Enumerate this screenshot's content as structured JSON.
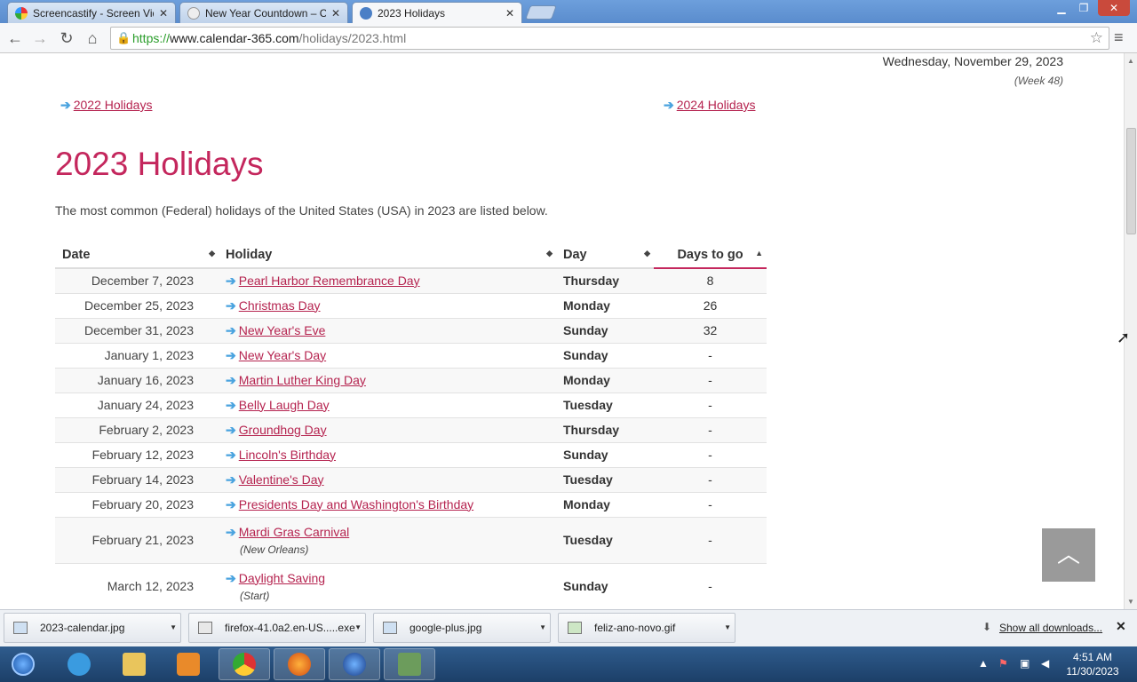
{
  "browser": {
    "tabs": [
      {
        "title": "Screencastify - Screen Vid",
        "active": false
      },
      {
        "title": "New Year Countdown – C",
        "active": false
      },
      {
        "title": "2023 Holidays",
        "active": true
      }
    ],
    "url_scheme": "https://",
    "url_host": "www.calendar-365.com",
    "url_path": "/holidays/2023.html"
  },
  "page": {
    "current_date": "Wednesday, November 29, 2023",
    "current_week": "(Week 48)",
    "prev_link": "2022 Holidays",
    "next_link": "2024 Holidays",
    "title": "2023 Holidays",
    "intro": "The most common (Federal) holidays of the United States (USA) in 2023 are listed below.",
    "table": {
      "headers": {
        "date": "Date",
        "holiday": "Holiday",
        "day": "Day",
        "days_to_go": "Days to go"
      },
      "rows": [
        {
          "date": "December 7, 2023",
          "holiday": "Pearl Harbor Remembrance Day",
          "note": "",
          "day": "Thursday",
          "days_to_go": "8"
        },
        {
          "date": "December 25, 2023",
          "holiday": "Christmas Day",
          "note": "",
          "day": "Monday",
          "days_to_go": "26"
        },
        {
          "date": "December 31, 2023",
          "holiday": "New Year's Eve",
          "note": "",
          "day": "Sunday",
          "days_to_go": "32"
        },
        {
          "date": "January 1, 2023",
          "holiday": "New Year's Day",
          "note": "",
          "day": "Sunday",
          "days_to_go": "-"
        },
        {
          "date": "January 16, 2023",
          "holiday": "Martin Luther King Day",
          "note": "",
          "day": "Monday",
          "days_to_go": "-"
        },
        {
          "date": "January 24, 2023",
          "holiday": "Belly Laugh Day",
          "note": "",
          "day": "Tuesday",
          "days_to_go": "-"
        },
        {
          "date": "February 2, 2023",
          "holiday": "Groundhog Day",
          "note": "",
          "day": "Thursday",
          "days_to_go": "-"
        },
        {
          "date": "February 12, 2023",
          "holiday": "Lincoln's Birthday",
          "note": "",
          "day": "Sunday",
          "days_to_go": "-"
        },
        {
          "date": "February 14, 2023",
          "holiday": "Valentine's Day",
          "note": "",
          "day": "Tuesday",
          "days_to_go": "-"
        },
        {
          "date": "February 20, 2023",
          "holiday": "Presidents Day and Washington's Birthday",
          "note": "",
          "day": "Monday",
          "days_to_go": "-"
        },
        {
          "date": "February 21, 2023",
          "holiday": "Mardi Gras Carnival",
          "note": "(New Orleans)",
          "day": "Tuesday",
          "days_to_go": "-"
        },
        {
          "date": "March 12, 2023",
          "holiday": "Daylight Saving",
          "note": "(Start)",
          "day": "Sunday",
          "days_to_go": "-"
        }
      ]
    }
  },
  "downloads": {
    "items": [
      "2023-calendar.jpg",
      "firefox-41.0a2.en-US.....exe",
      "google-plus.jpg",
      "feliz-ano-novo.gif"
    ],
    "show_all": "Show all downloads..."
  },
  "taskbar": {
    "time": "4:51 AM",
    "date": "11/30/2023"
  }
}
